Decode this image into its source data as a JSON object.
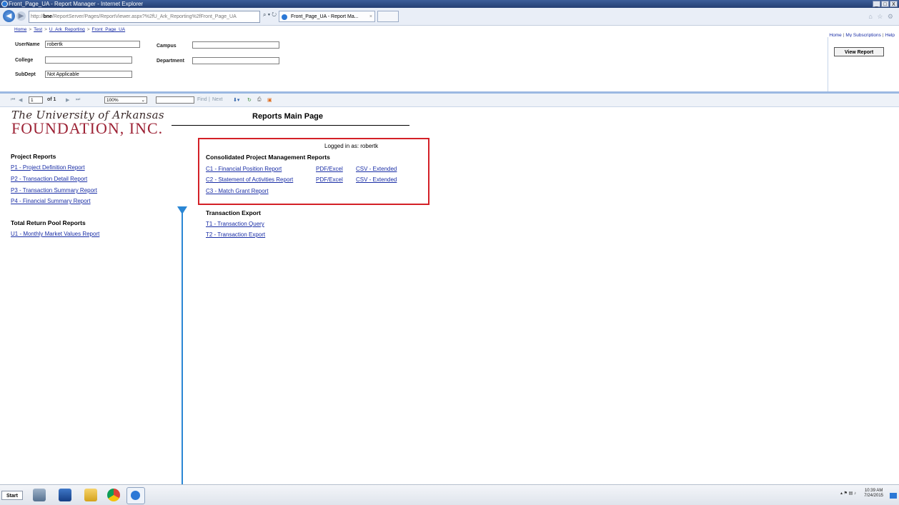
{
  "window": {
    "title": "Front_Page_UA - Report Manager - Internet Explorer",
    "controls": [
      "_",
      "□",
      "X"
    ]
  },
  "browser": {
    "back": "◀",
    "forward": "▶",
    "address_host": "bne",
    "address_rest": "/ReportServer/Pages/ReportViewer.aspx?%2fU_Ark_Reporting%2fFront_Page_UA",
    "address_icons": "⌕ ▾ ↻",
    "tab_label": "Front_Page_UA - Report Ma...",
    "tab_close": "×",
    "star_icons": "⌂ ☆ ⚙"
  },
  "breadcrumb": [
    "Home",
    "Test",
    "U_Ark_Reporting",
    "Front_Page_UA"
  ],
  "breadcrumb_sep": ">",
  "top_links": [
    "Home",
    "My Subscriptions",
    "Help"
  ],
  "top_links_sep": "|",
  "params": {
    "username_label": "UserName",
    "username_value": "robertk",
    "campus_label": "Campus",
    "campus_value": "",
    "college_label": "College",
    "college_value": "",
    "department_label": "Department",
    "department_value": "",
    "subdept_label": "SubDept",
    "subdept_value": "Not Applicable",
    "chevron": "⌄"
  },
  "view_report_label": "View Report",
  "toolbar": {
    "first": "⏮",
    "prev": "◀",
    "page_value": "1",
    "of_label": "of 1",
    "next": "▶",
    "last": "⏭",
    "zoom_value": "100%",
    "find_value": "",
    "find_label": "Find",
    "next_label": "Next",
    "find_sep": "|",
    "export_icon": "⬇▾",
    "refresh_icon": "↻",
    "print_icon": "⎙",
    "feed_icon": "▣"
  },
  "logo": {
    "line1": "The University of Arkansas",
    "line2": "FOUNDATION, INC."
  },
  "report_title": "Reports Main Page",
  "logged_in": "Logged in as: robertk",
  "project_reports": {
    "heading": "Project Reports",
    "links": [
      "P1 - Project Definition Report",
      "P2 - Transaction Detail Report",
      "P3 - Transaction Summary Report",
      "P4 - Financial Summary Report"
    ]
  },
  "pool_reports": {
    "heading": "Total Return Pool Reports",
    "links": [
      "U1 - Monthly Market Values Report"
    ]
  },
  "consolidated": {
    "heading": "Consolidated Project Management Reports",
    "c1": "C1 - Financial Position Report",
    "c2": "C2 - Statement of Activities Report",
    "c3": "C3 - Match Grant Report",
    "pdf": "PDF/Excel",
    "csv": "CSV - Extended"
  },
  "transaction_export": {
    "heading": "Transaction Export",
    "links": [
      "T1 - Transaction Query",
      "T2 - Transaction Export"
    ]
  },
  "taskbar": {
    "start": "Start",
    "clock_time": "10:39 AM",
    "clock_date": "7/24/2015",
    "tray": "▴ ⚑ ▤ ♪"
  },
  "colors": {
    "link": "#1a2ea6",
    "logo_red": "#9d2235",
    "highlight": "#d42027",
    "arrow": "#2a86d4"
  }
}
